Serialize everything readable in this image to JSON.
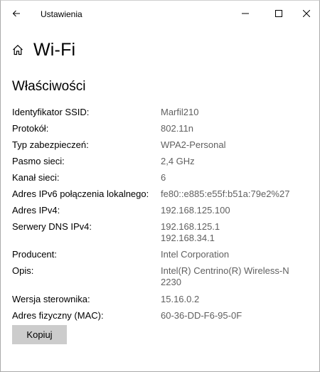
{
  "window": {
    "title": "Ustawienia"
  },
  "page": {
    "title": "Wi-Fi",
    "section_title": "Właściwości"
  },
  "properties": [
    {
      "label": "Identyfikator SSID:",
      "value": [
        "Marfil210"
      ]
    },
    {
      "label": "Protokół:",
      "value": [
        "802.11n"
      ]
    },
    {
      "label": "Typ zabezpieczeń:",
      "value": [
        "WPA2-Personal"
      ]
    },
    {
      "label": "Pasmo sieci:",
      "value": [
        "2,4 GHz"
      ]
    },
    {
      "label": "Kanał sieci:",
      "value": [
        "6"
      ]
    },
    {
      "label": "Adres IPv6 połączenia lokalnego:",
      "value": [
        "fe80::e885:e55f:b51a:79e2%27"
      ]
    },
    {
      "label": "Adres IPv4:",
      "value": [
        "192.168.125.100"
      ]
    },
    {
      "label": "Serwery DNS IPv4:",
      "value": [
        "192.168.125.1",
        "192.168.34.1"
      ]
    },
    {
      "label": "Producent:",
      "value": [
        "Intel Corporation"
      ]
    },
    {
      "label": "Opis:",
      "value": [
        "Intel(R) Centrino(R) Wireless-N",
        "2230"
      ]
    },
    {
      "label": "Wersja sterownika:",
      "value": [
        "15.16.0.2"
      ]
    },
    {
      "label": "Adres fizyczny (MAC):",
      "value": [
        "60-36-DD-F6-95-0F"
      ]
    }
  ],
  "actions": {
    "copy_label": "Kopiuj"
  },
  "colors": {
    "value_text": "#606060",
    "button_bg": "#cccccc"
  },
  "icons": {
    "back": "back-arrow-icon",
    "home": "home-icon",
    "minimize": "minimize-icon",
    "maximize": "maximize-icon",
    "close": "close-icon"
  }
}
